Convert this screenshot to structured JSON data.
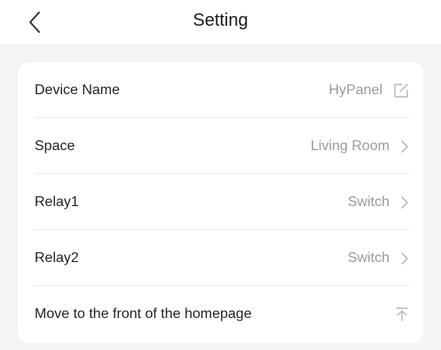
{
  "header": {
    "title": "Setting",
    "back_icon": "chevron-left-icon"
  },
  "settings": {
    "device_name": {
      "label": "Device Name",
      "value": "HyPanel",
      "icon": "edit-icon"
    },
    "space": {
      "label": "Space",
      "value": "Living Room",
      "icon": "chevron-right-icon"
    },
    "relay1": {
      "label": "Relay1",
      "value": "Switch",
      "icon": "chevron-right-icon"
    },
    "relay2": {
      "label": "Relay2",
      "value": "Switch",
      "icon": "chevron-right-icon"
    },
    "move_to_front": {
      "label": "Move to the front of the homepage",
      "icon": "pin-to-top-icon"
    }
  },
  "colors": {
    "background": "#f4f4f6",
    "card": "#ffffff",
    "text_primary": "#222222",
    "text_secondary": "#9a9a9a",
    "divider": "#ededed"
  }
}
